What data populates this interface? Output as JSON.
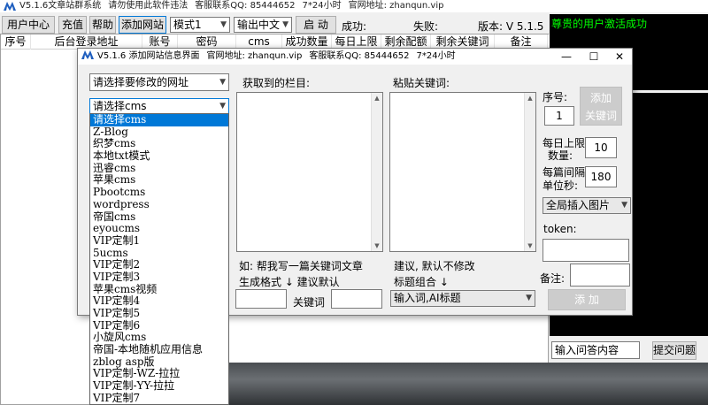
{
  "main": {
    "title_segments": [
      "V5.1.6文章站群系统",
      "请勿使用此软件违法",
      "客服联系QQ: 85444652",
      "7*24小时",
      "官网地址: zhanqun.vip"
    ],
    "toolbar": {
      "user_center": "用户中心",
      "recharge": "充值",
      "help": "帮助",
      "add_site": "添加网站",
      "mode": "模式1",
      "output_lang": "输出中文",
      "start": "启 动",
      "success_label": "成功:",
      "fail_label": "失败:",
      "version": "版本: V 5.1.5"
    },
    "columns": [
      "序号",
      "后台登录地址",
      "账号",
      "密码",
      "cms",
      "成功数量",
      "每日上限",
      "剩余配额",
      "剩余关键词",
      "备注"
    ],
    "right_panel": {
      "activation_msg": "尊贵的用户激活成功",
      "qa_input": "输入问答内容",
      "submit_qa": "提交问题"
    }
  },
  "dialog": {
    "title_segments": [
      "V5.1.6 添加网站信息界面",
      "官网地址: zhanqun.vip",
      "客服联系QQ: 85444652",
      "7*24小时"
    ],
    "site_select": "请选择要修改的网址",
    "cms_select": "请选择cms",
    "column_label": "获取到的栏目:",
    "keyword_label": "粘贴关键词:",
    "example_text": "如: 帮我写一篇关键词文章",
    "gen_format": "生成格式 ↓ 建议默认",
    "keyword_field_label": "关键词",
    "suggest_text": "建议, 默认不修改",
    "title_combo": "标题组合 ↓",
    "title_select": "输入词,AI标题",
    "seq_label": "序号:",
    "seq_value": "1",
    "add_keyword_btn_1": "添加",
    "add_keyword_btn_2": "关键词",
    "daily_limit_1": "每日上限",
    "daily_limit_2": "数量:",
    "daily_limit_value": "10",
    "interval_1": "每篇间隔",
    "interval_2": "单位秒:",
    "interval_value": "180",
    "insert_image": "全局插入图片",
    "token_label": "token:",
    "note_label": "备注:",
    "add_btn": "添 加"
  },
  "dropdown": {
    "options": [
      "请选择cms",
      "Z-Blog",
      "织梦cms",
      "本地txt模式",
      "迅睿cms",
      "苹果cms",
      "Pbootcms",
      "wordpress",
      "帝国cms",
      "eyoucms",
      "VIP定制1",
      "5ucms",
      "VIP定制2",
      "VIP定制3",
      "苹果cms视频",
      "VIP定制4",
      "VIP定制5",
      "VIP定制6",
      "小旋风cms",
      "帝国-本地随机应用信息",
      "zblog asp版",
      "VIP定制-WZ-拉拉",
      "VIP定制-YY-拉拉",
      "VIP定制7"
    ],
    "selected_index": 0
  },
  "colors": {
    "selection": "#0078d7",
    "activation_text": "#00ff00",
    "panel_black": "#000000"
  }
}
